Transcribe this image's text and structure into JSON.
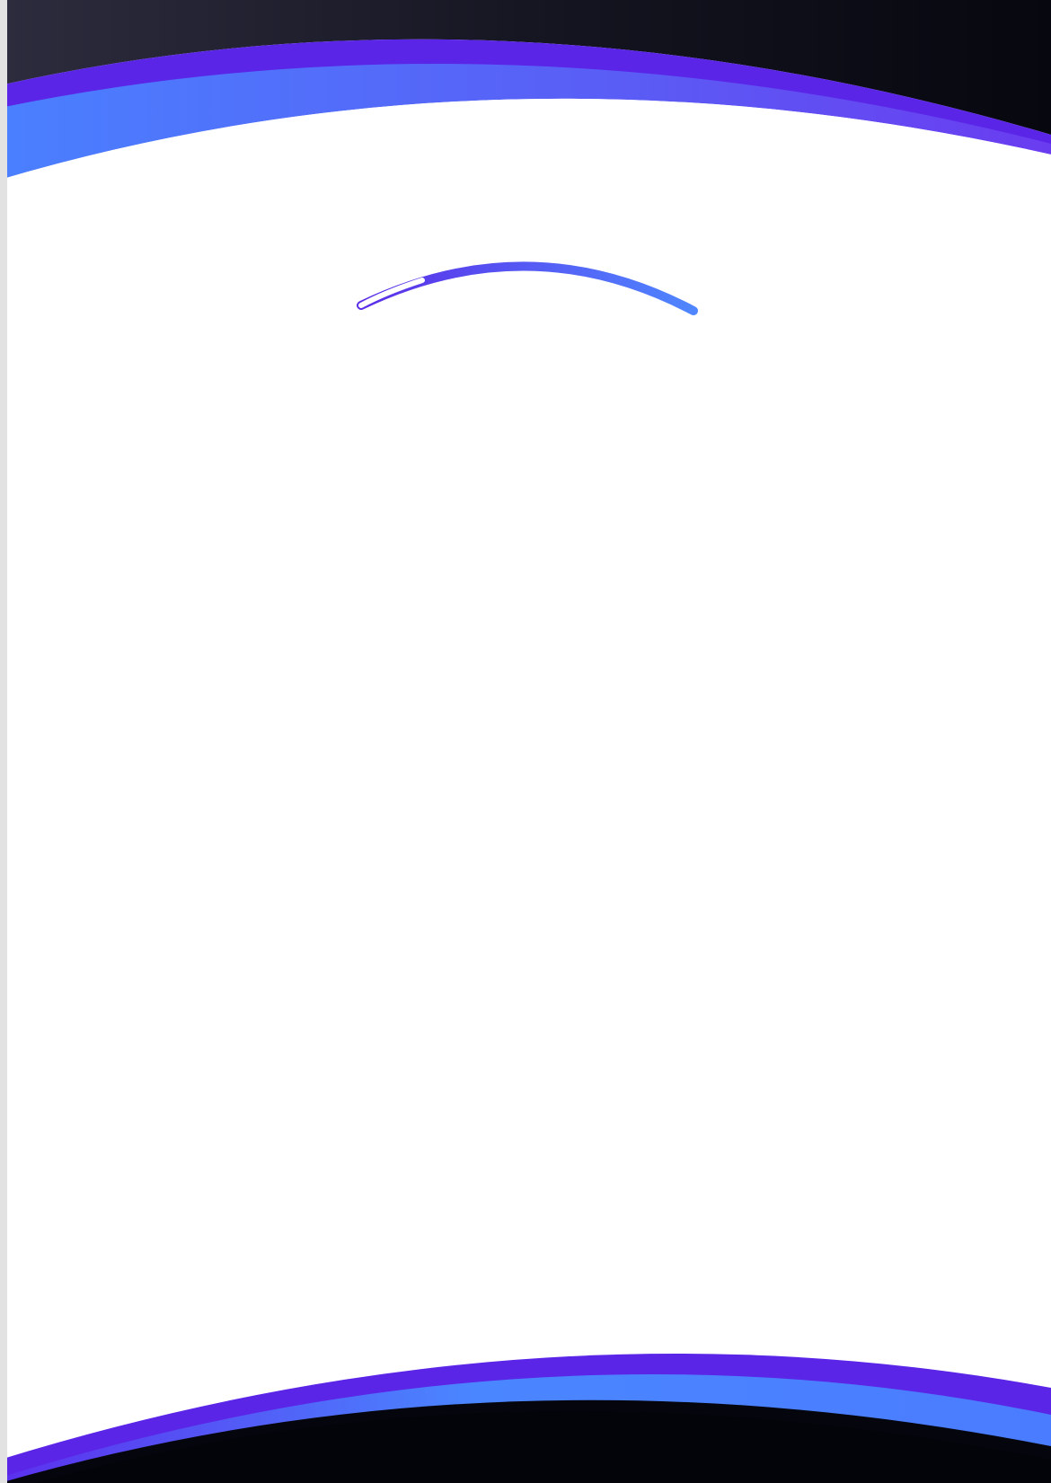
{
  "document": {
    "kind": "letterhead-template",
    "colors": {
      "dark_band": "#0a0a1a",
      "dark_band_light": "#2c2c3e",
      "purple_stripe": "#5b25e8",
      "blue_stripe": "#4a86ff",
      "page_background": "#ffffff",
      "left_edge": "#e2e2e2"
    }
  }
}
